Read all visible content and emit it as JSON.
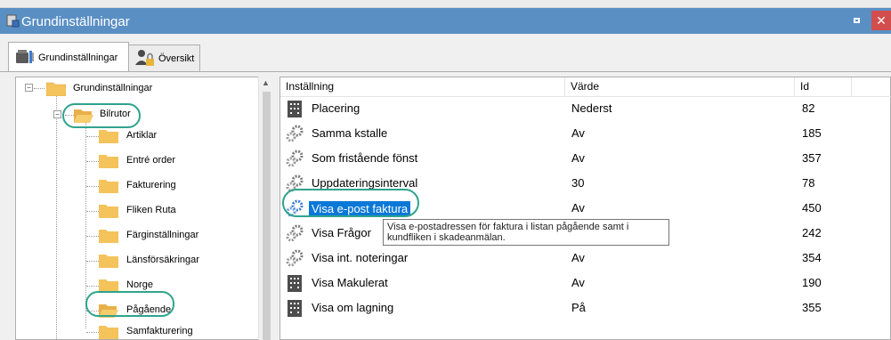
{
  "window": {
    "title": "Grundinställningar",
    "close_glyph": "✕"
  },
  "tabs": [
    {
      "label": "Grundinställningar",
      "icon": "settings-tools-icon"
    },
    {
      "label": "Översikt",
      "icon": "users-lock-icon"
    }
  ],
  "tree": {
    "root": "Grundinställningar",
    "selected_parent": "Bilrutor",
    "children": [
      "Artiklar",
      "Entré order",
      "Fakturering",
      "Fliken Ruta",
      "Färginställningar",
      "Länsförsäkringar",
      "Norge",
      "Pågående",
      "Samfakturering"
    ],
    "expander_minus": "−"
  },
  "table": {
    "headers": {
      "setting": "Inställning",
      "value": "Värde",
      "id": "Id"
    },
    "rows": [
      {
        "name": "Placering",
        "value": "Nederst",
        "id": "82",
        "icon": "building-icon"
      },
      {
        "name": "Samma kstalle",
        "value": "Av",
        "id": "185",
        "icon": "gears-icon"
      },
      {
        "name": "Som fristående fönst",
        "value": "Av",
        "id": "357",
        "icon": "gears-icon"
      },
      {
        "name": "Uppdateringsinterval",
        "value": "30",
        "id": "78",
        "icon": "gears-icon"
      },
      {
        "name": "Visa e-post faktura",
        "value": "Av",
        "id": "450",
        "icon": "gears-icon",
        "selected": true
      },
      {
        "name": "Visa Frågor",
        "value": "",
        "id": "242",
        "icon": "gears-icon"
      },
      {
        "name": "Visa int. noteringar",
        "value": "Av",
        "id": "354",
        "icon": "gears-icon"
      },
      {
        "name": "Visa Makulerat",
        "value": "Av",
        "id": "190",
        "icon": "building-icon"
      },
      {
        "name": "Visa om lagning",
        "value": "På",
        "id": "355",
        "icon": "building-icon"
      }
    ]
  },
  "tooltip": {
    "line1": "Visa e-postadressen för faktura i listan pågående samt i",
    "line2": "kundfliken i skadeanmälan."
  },
  "colors": {
    "titlebar": "#5a8fc4",
    "selection": "#0a78d7",
    "highlight_ring": "#2fa38d",
    "folder": "#f4c35c"
  }
}
